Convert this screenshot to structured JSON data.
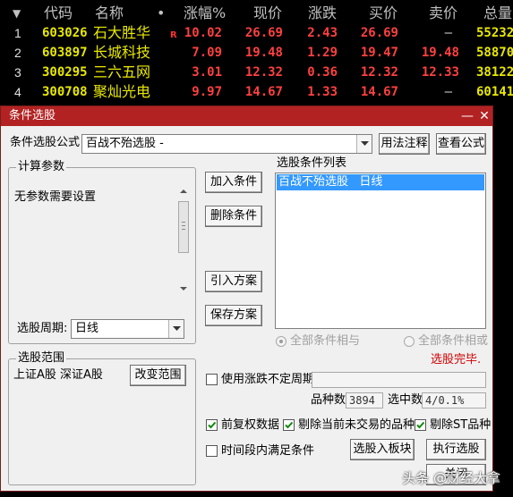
{
  "quote_table": {
    "columns": [
      "代码",
      "名称",
      "•",
      "涨幅%",
      "现价",
      "涨跌",
      "买价",
      "卖价",
      "总量"
    ],
    "rows": [
      {
        "idx": "1",
        "code": "603026",
        "name": "石大胜华",
        "flag": "R",
        "change_pct": "10.02",
        "price": "26.69",
        "change": "2.43",
        "bid": "26.69",
        "ask": "—",
        "volume": "55232"
      },
      {
        "idx": "2",
        "code": "603897",
        "name": "长城科技",
        "flag": "",
        "change_pct": "7.09",
        "price": "19.48",
        "change": "1.29",
        "bid": "19.47",
        "ask": "19.48",
        "volume": "58870"
      },
      {
        "idx": "3",
        "code": "300295",
        "name": "三六五网",
        "flag": "",
        "change_pct": "3.01",
        "price": "12.32",
        "change": "0.36",
        "bid": "12.32",
        "ask": "12.33",
        "volume": "38122"
      },
      {
        "idx": "4",
        "code": "300708",
        "name": "聚灿光电",
        "flag": "",
        "change_pct": "9.97",
        "price": "14.67",
        "change": "1.33",
        "bid": "14.67",
        "ask": "—",
        "volume": "60141"
      }
    ]
  },
  "dialog": {
    "title": "条件选股",
    "formula_label": "条件选股公式",
    "formula_value": "百战不殆选股 -",
    "usage_button": "用法注释",
    "view_button": "查看公式",
    "calc_params_title": "计算参数",
    "no_params_text": "无参数需要设置",
    "period_label": "选股周期:",
    "period_value": "日线",
    "add_condition": "加入条件",
    "delete_condition": "删除条件",
    "import_plan": "引入方案",
    "save_plan": "保存方案",
    "condition_list_label": "选股条件列表",
    "conditions": [
      "百战不殆选股   日线"
    ],
    "radio_and": "全部条件相与",
    "radio_or": "全部条件相或",
    "status_text": "选股完毕.",
    "scope_title": "选股范围",
    "scope_value": "上证A股 深证A股",
    "change_scope": "改变范围",
    "use_variable_period": "使用涨跌不定周期",
    "stock_count_label": "品种数",
    "stock_count_value": "3894",
    "selected_label": "选中数",
    "selected_value": "4/0.1%",
    "forward_adjust": "前复权数据",
    "exclude_suspended": "剔除当前未交易的品种",
    "exclude_st": "剔除ST品种",
    "time_range_condition": "时间段内满足条件",
    "to_block": "选股入板块",
    "execute": "执行选股",
    "close": "关闭"
  },
  "watermark": "头条 @财经大拿",
  "colors": {
    "title_bar": "#b22222",
    "selected_item": "#3399ff",
    "status_red": "#d00000",
    "quote_up": "#ff4040",
    "quote_code": "#e8e800"
  }
}
